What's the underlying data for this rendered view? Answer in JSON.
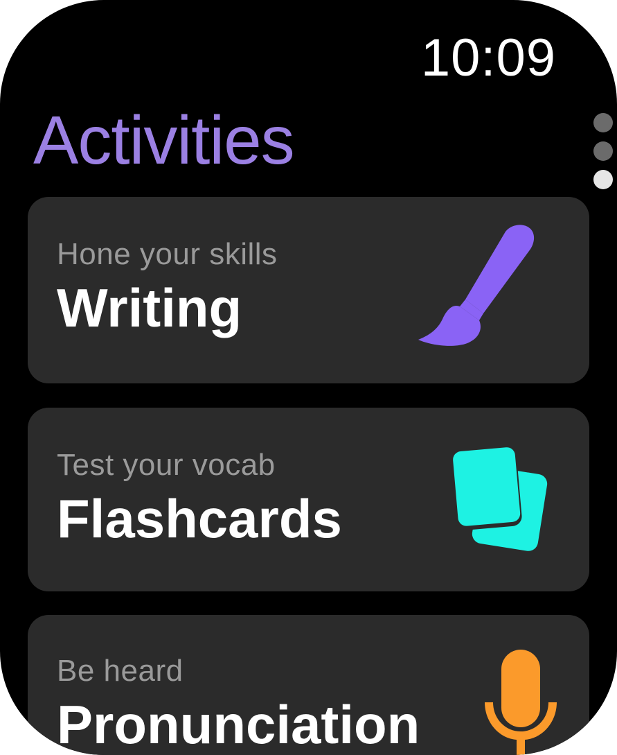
{
  "status_bar": {
    "time": "10:09"
  },
  "header": {
    "title": "Activities",
    "title_color": "#9b80e3"
  },
  "page_indicator": {
    "count": 3,
    "active_index": 2
  },
  "activities": [
    {
      "subtitle": "Hone your skills",
      "title": "Writing",
      "icon": "paintbrush-icon",
      "icon_color": "#8a63f5"
    },
    {
      "subtitle": "Test your vocab",
      "title": "Flashcards",
      "icon": "flashcards-icon",
      "icon_color": "#1ef2e3"
    },
    {
      "subtitle": "Be heard",
      "title": "Pronunciation",
      "icon": "microphone-icon",
      "icon_color": "#fb9a2b"
    }
  ]
}
